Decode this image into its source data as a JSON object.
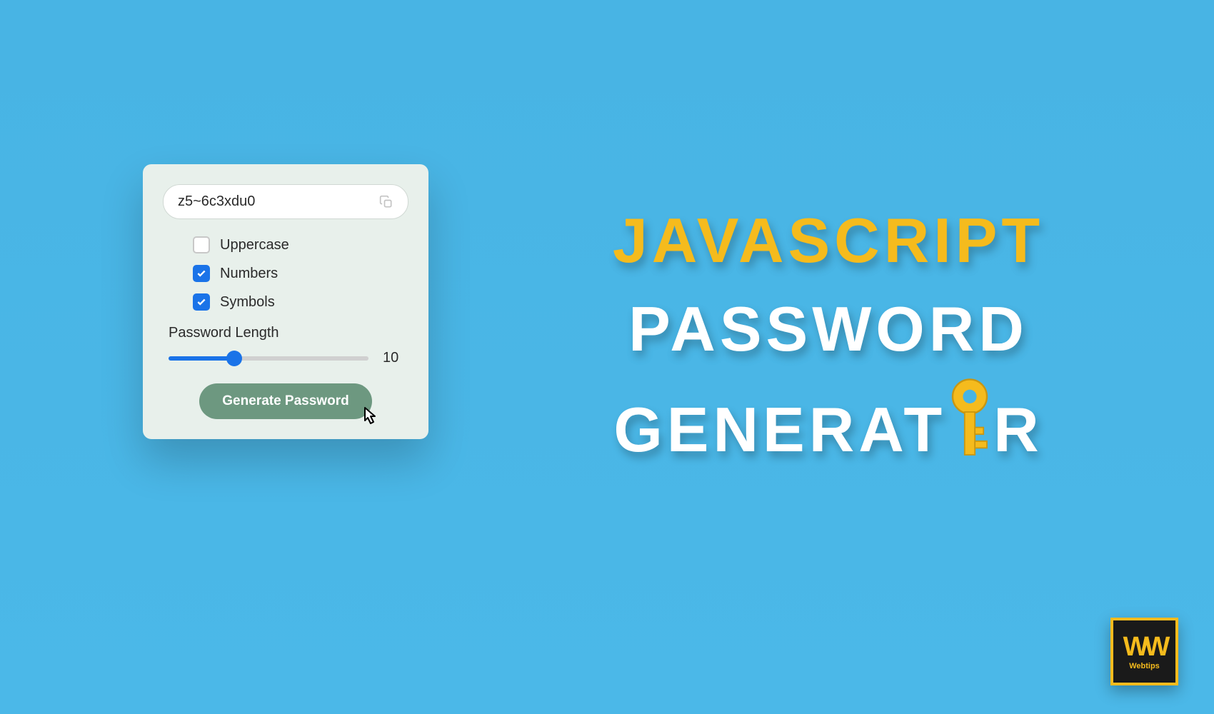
{
  "card": {
    "password_value": "z5~6c3xdu0",
    "options": {
      "uppercase": {
        "label": "Uppercase",
        "checked": false
      },
      "numbers": {
        "label": "Numbers",
        "checked": true
      },
      "symbols": {
        "label": "Symbols",
        "checked": true
      }
    },
    "slider": {
      "label": "Password Length",
      "value": "10",
      "percent": 33
    },
    "generate_button": "Generate Password"
  },
  "title": {
    "line1": "JAVASCRIPT",
    "line2": "PASSWORD",
    "line3_part1": "GENERAT",
    "line3_part2": "R"
  },
  "logo": {
    "mark": "WW",
    "text": "Webtips"
  }
}
